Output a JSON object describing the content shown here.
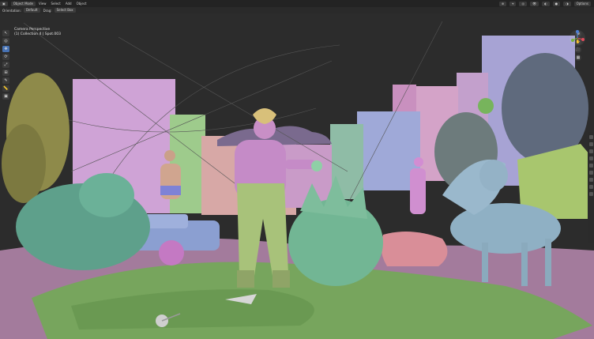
{
  "header": {
    "mode": "Object Mode",
    "menus": [
      "View",
      "Select",
      "Add",
      "Object"
    ],
    "options": "Options"
  },
  "toolbar2": {
    "orientation_label": "Orientation:",
    "orientation_value": "Default",
    "drag_label": "Drag:",
    "drag_value": "Select Box"
  },
  "viewport": {
    "view_name": "Camera Perspective",
    "collection": "(1) Collection 4 | Spot.003"
  },
  "colors": {
    "sky": "#2b2b2b",
    "pink": "#d9a8d6",
    "green": "#8fbf7f",
    "teal": "#5d9a8a",
    "blue": "#9aa6d2",
    "ground": "#6b9e58",
    "accent": "#4772b3"
  },
  "icons": {
    "select": "cursor-icon",
    "cursor": "target-icon",
    "move": "move-icon",
    "rotate": "rotate-icon",
    "scale": "scale-icon",
    "transform": "transform-icon",
    "annotate": "pencil-icon",
    "measure": "ruler-icon",
    "add": "cube-icon"
  }
}
